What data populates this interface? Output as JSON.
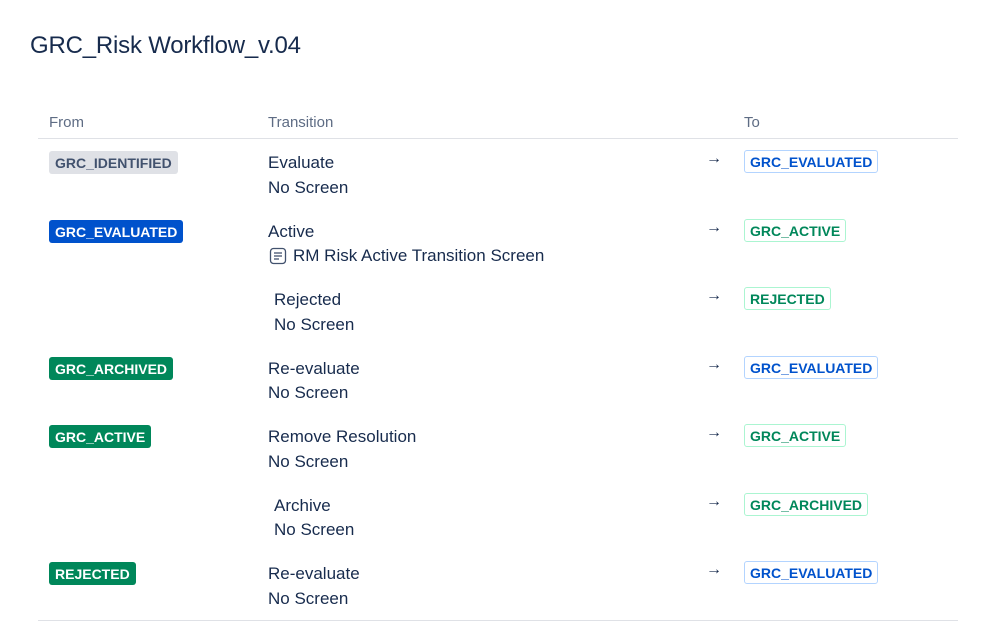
{
  "page": {
    "title": "GRC_Risk Workflow_v.04"
  },
  "table": {
    "headers": {
      "from": "From",
      "transition": "Transition",
      "to": "To"
    },
    "rows": [
      {
        "from": "GRC_IDENTIFIED",
        "from_style": "grey",
        "transition": "Evaluate",
        "screen": "No Screen",
        "screen_icon": false,
        "arrow": "→",
        "to": "GRC_EVALUATED",
        "to_style": "blue",
        "indent": false
      },
      {
        "from": "GRC_EVALUATED",
        "from_style": "blue",
        "transition": "Active",
        "screen": "RM Risk Active Transition Screen",
        "screen_icon": true,
        "arrow": "→",
        "to": "GRC_ACTIVE",
        "to_style": "green",
        "indent": false
      },
      {
        "from": "",
        "from_style": "",
        "transition": "Rejected",
        "screen": "No Screen",
        "screen_icon": false,
        "arrow": "→",
        "to": "REJECTED",
        "to_style": "green",
        "indent": true
      },
      {
        "from": "GRC_ARCHIVED",
        "from_style": "green",
        "transition": "Re-evaluate",
        "screen": "No Screen",
        "screen_icon": false,
        "arrow": "→",
        "to": "GRC_EVALUATED",
        "to_style": "blue",
        "indent": false
      },
      {
        "from": "GRC_ACTIVE",
        "from_style": "green",
        "transition": "Remove Resolution",
        "screen": "No Screen",
        "screen_icon": false,
        "arrow": "→",
        "to": "GRC_ACTIVE",
        "to_style": "green",
        "indent": false
      },
      {
        "from": "",
        "from_style": "",
        "transition": "Archive",
        "screen": "No Screen",
        "screen_icon": false,
        "arrow": "→",
        "to": "GRC_ARCHIVED",
        "to_style": "green",
        "indent": true
      },
      {
        "from": "REJECTED",
        "from_style": "green",
        "transition": "Re-evaluate",
        "screen": "No Screen",
        "screen_icon": false,
        "arrow": "→",
        "to": "GRC_EVALUATED",
        "to_style": "blue",
        "indent": false
      }
    ]
  },
  "colors": {
    "status_grey": "#dfe1e6",
    "status_blue": "#0052cc",
    "status_green": "#00875a",
    "text": "#172b4d",
    "header_text": "#5e6c84"
  },
  "icons": {
    "screen_icon": "screen-form-icon",
    "arrow": "right-arrow-icon"
  }
}
